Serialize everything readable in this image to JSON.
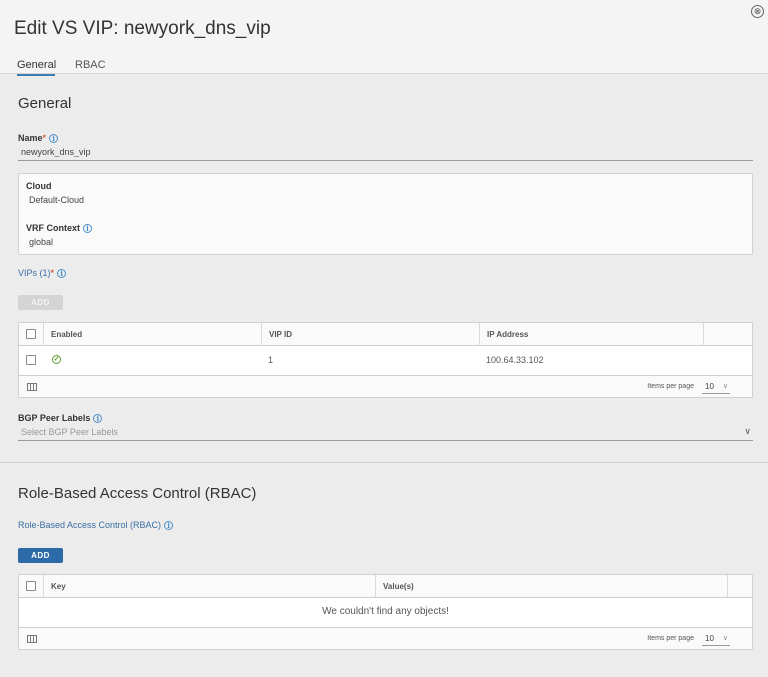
{
  "window": {
    "title": "Edit VS VIP: newyork_dns_vip",
    "close_glyph": "⊗"
  },
  "tabs": [
    {
      "label": "General",
      "active": true
    },
    {
      "label": "RBAC",
      "active": false
    }
  ],
  "general": {
    "section_title": "General",
    "name_label": "Name",
    "name_value": "newyork_dns_vip",
    "required_mark": "*",
    "cloud_label": "Cloud",
    "cloud_value": "Default-Cloud",
    "vrf_label": "VRF Context",
    "vrf_value": "global",
    "vips_label": "VIPs (1)",
    "add_label": "ADD",
    "vip_table": {
      "headers": [
        "Enabled",
        "VIP ID",
        "IP Address"
      ],
      "rows": [
        {
          "enabled": true,
          "vip_id": "1",
          "ip_address": "100.64.33.102"
        }
      ],
      "items_per_page_label": "Items per page",
      "items_per_page_value": "10"
    },
    "bgp_label": "BGP Peer Labels",
    "bgp_placeholder": "Select BGP Peer Labels"
  },
  "rbac": {
    "section_title": "Role-Based Access Control (RBAC)",
    "sub_label": "Role-Based Access Control (RBAC)",
    "add_label": "ADD",
    "table": {
      "headers": [
        "Key",
        "Value(s)"
      ],
      "empty_message": "We couldn't find any objects!",
      "items_per_page_label": "Items per page",
      "items_per_page_value": "10"
    }
  },
  "colors": {
    "primary": "#2c6aa8",
    "link": "#3c6ea3",
    "required": "#c92100",
    "success": "#5e9d2d"
  }
}
